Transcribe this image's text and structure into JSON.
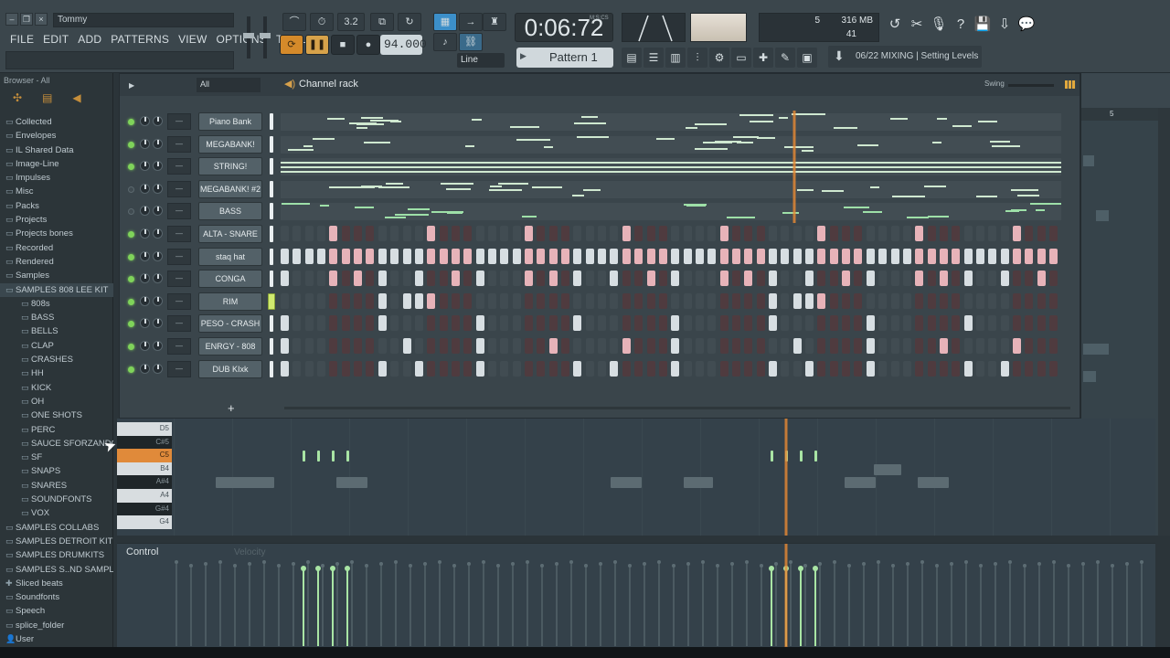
{
  "window": {
    "title": "Tommy",
    "menu": [
      "FILE",
      "EDIT",
      "ADD",
      "PATTERNS",
      "VIEW",
      "OPTIONS",
      "TOOLS",
      "?"
    ]
  },
  "transport": {
    "tempo": "94.000",
    "time": "0:06:72",
    "time_unit": "M:S:CS",
    "pattern": "Pattern 1",
    "snap": "Line",
    "counter_top": "3.2",
    "cpu_value": "5",
    "memory": "316 MB",
    "polyphony": "41"
  },
  "hint": {
    "text": "06/22  MIXING | Setting Levels"
  },
  "browser": {
    "header": "Browser - All",
    "items": [
      {
        "label": "Collected",
        "icon": "folder-icon",
        "level": 0
      },
      {
        "label": "Envelopes",
        "icon": "folder-icon",
        "level": 0
      },
      {
        "label": "IL Shared Data",
        "icon": "folder-icon",
        "level": 0
      },
      {
        "label": "Image-Line",
        "icon": "folder-icon",
        "level": 0
      },
      {
        "label": "Impulses",
        "icon": "folder-icon",
        "level": 0
      },
      {
        "label": "Misc",
        "icon": "folder-icon",
        "level": 0
      },
      {
        "label": "Packs",
        "icon": "folder-icon",
        "level": 0
      },
      {
        "label": "Projects",
        "icon": "folder-icon",
        "level": 0
      },
      {
        "label": "Projects bones",
        "icon": "folder-icon",
        "level": 0
      },
      {
        "label": "Recorded",
        "icon": "folder-icon",
        "level": 0
      },
      {
        "label": "Rendered",
        "icon": "folder-icon",
        "level": 0
      },
      {
        "label": "Samples",
        "icon": "folder-icon",
        "level": 0
      },
      {
        "label": "SAMPLES 808 LEE KIT",
        "icon": "folder-open-icon",
        "level": 0
      },
      {
        "label": "808s",
        "icon": "folder-icon",
        "level": 1
      },
      {
        "label": "BASS",
        "icon": "folder-icon",
        "level": 1
      },
      {
        "label": "BELLS",
        "icon": "folder-icon",
        "level": 1
      },
      {
        "label": "CLAP",
        "icon": "folder-icon",
        "level": 1
      },
      {
        "label": "CRASHES",
        "icon": "folder-icon",
        "level": 1
      },
      {
        "label": "HH",
        "icon": "folder-icon",
        "level": 1
      },
      {
        "label": "KICK",
        "icon": "folder-icon",
        "level": 1
      },
      {
        "label": "OH",
        "icon": "folder-icon",
        "level": 1
      },
      {
        "label": "ONE SHOTS",
        "icon": "folder-icon",
        "level": 1
      },
      {
        "label": "PERC",
        "icon": "folder-icon",
        "level": 1
      },
      {
        "label": "SAUCE SFORZANDO",
        "icon": "folder-icon",
        "level": 1
      },
      {
        "label": "SF",
        "icon": "folder-icon",
        "level": 1
      },
      {
        "label": "SNAPS",
        "icon": "folder-icon",
        "level": 1
      },
      {
        "label": "SNARES",
        "icon": "folder-icon",
        "level": 1
      },
      {
        "label": "SOUNDFONTS",
        "icon": "folder-icon",
        "level": 1
      },
      {
        "label": "VOX",
        "icon": "folder-icon",
        "level": 1
      },
      {
        "label": "SAMPLES COLLABS",
        "icon": "folder-icon",
        "level": 0
      },
      {
        "label": "SAMPLES DETROIT KITS",
        "icon": "folder-icon",
        "level": 0
      },
      {
        "label": "SAMPLES DRUMKITS",
        "icon": "folder-icon",
        "level": 0
      },
      {
        "label": "SAMPLES S..ND SAMPLES",
        "icon": "folder-icon",
        "level": 0
      },
      {
        "label": "Sliced beats",
        "icon": "sliced-icon",
        "level": 0
      },
      {
        "label": "Soundfonts",
        "icon": "folder-icon",
        "level": 0
      },
      {
        "label": "Speech",
        "icon": "folder-icon",
        "level": 0
      },
      {
        "label": "splice_folder",
        "icon": "folder-icon",
        "level": 0
      },
      {
        "label": "User",
        "icon": "user-icon",
        "level": 0
      }
    ]
  },
  "channel_rack": {
    "title": "Channel rack",
    "filter": "All",
    "swing_label": "Swing",
    "channels": [
      {
        "name": "Piano Bank",
        "led": true,
        "type": "roll"
      },
      {
        "name": "MEGABANK!",
        "led": true,
        "type": "roll"
      },
      {
        "name": "STRING!",
        "led": true,
        "type": "roll"
      },
      {
        "name": "MEGABANK! #2",
        "led": false,
        "type": "roll"
      },
      {
        "name": "BASS",
        "led": false,
        "type": "roll"
      },
      {
        "name": "ALTA - SNARE",
        "led": true,
        "type": "steps",
        "steps": [
          0,
          0,
          0,
          0,
          1,
          0,
          0,
          0,
          0,
          0,
          0,
          0,
          1,
          0,
          0,
          0,
          0,
          0,
          0,
          0,
          1,
          0,
          0,
          0,
          0,
          0,
          0,
          0,
          1,
          0,
          0,
          0,
          0,
          0,
          0,
          0,
          1,
          0,
          0,
          0,
          0,
          0,
          0,
          0,
          1,
          0,
          0,
          0,
          0,
          0,
          0,
          0,
          1,
          0,
          0,
          0,
          0,
          0,
          0,
          0,
          1,
          0,
          0,
          0
        ]
      },
      {
        "name": "staq hat",
        "led": true,
        "type": "steps",
        "steps": [
          1,
          1,
          1,
          1,
          1,
          1,
          1,
          1,
          1,
          1,
          1,
          1,
          1,
          1,
          1,
          1,
          1,
          1,
          1,
          1,
          1,
          1,
          1,
          1,
          1,
          1,
          1,
          1,
          1,
          1,
          1,
          1,
          1,
          1,
          1,
          1,
          1,
          1,
          1,
          1,
          1,
          1,
          1,
          1,
          1,
          1,
          1,
          1,
          1,
          1,
          1,
          1,
          1,
          1,
          1,
          1,
          1,
          1,
          1,
          1,
          1,
          1,
          1,
          1
        ]
      },
      {
        "name": "CONGA",
        "led": true,
        "type": "steps",
        "steps": [
          1,
          0,
          0,
          0,
          1,
          0,
          1,
          0,
          1,
          0,
          0,
          1,
          0,
          0,
          1,
          0,
          1,
          0,
          0,
          0,
          1,
          0,
          1,
          0,
          1,
          0,
          0,
          1,
          0,
          0,
          1,
          0,
          1,
          0,
          0,
          0,
          1,
          0,
          1,
          0,
          1,
          0,
          0,
          1,
          0,
          0,
          1,
          0,
          1,
          0,
          0,
          0,
          1,
          0,
          1,
          0,
          1,
          0,
          0,
          1,
          0,
          0,
          1,
          0
        ]
      },
      {
        "name": "RIM",
        "led": true,
        "type": "steps",
        "selected": true,
        "steps": [
          0,
          0,
          0,
          0,
          0,
          0,
          0,
          0,
          1,
          0,
          1,
          1,
          1,
          0,
          0,
          0,
          0,
          0,
          0,
          0,
          0,
          0,
          0,
          0,
          0,
          0,
          0,
          0,
          0,
          0,
          0,
          0,
          0,
          0,
          0,
          0,
          0,
          0,
          0,
          0,
          1,
          0,
          1,
          1,
          1,
          0,
          0,
          0,
          0,
          0,
          0,
          0,
          0,
          0,
          0,
          0,
          0,
          0,
          0,
          0,
          0,
          0,
          0,
          0
        ]
      },
      {
        "name": "PESO - CRASH",
        "led": true,
        "type": "steps",
        "steps": [
          1,
          0,
          0,
          0,
          0,
          0,
          0,
          0,
          1,
          0,
          0,
          0,
          0,
          0,
          0,
          0,
          1,
          0,
          0,
          0,
          0,
          0,
          0,
          0,
          1,
          0,
          0,
          0,
          0,
          0,
          0,
          0,
          1,
          0,
          0,
          0,
          0,
          0,
          0,
          0,
          1,
          0,
          0,
          0,
          0,
          0,
          0,
          0,
          1,
          0,
          0,
          0,
          0,
          0,
          0,
          0,
          1,
          0,
          0,
          0,
          0,
          0,
          0,
          0
        ]
      },
      {
        "name": "ENRGY - 808",
        "led": true,
        "type": "steps",
        "steps": [
          1,
          0,
          0,
          0,
          0,
          0,
          0,
          0,
          0,
          0,
          1,
          0,
          0,
          0,
          0,
          0,
          1,
          0,
          0,
          0,
          0,
          0,
          1,
          0,
          0,
          0,
          0,
          0,
          1,
          0,
          0,
          0,
          1,
          0,
          0,
          0,
          0,
          0,
          0,
          0,
          0,
          0,
          1,
          0,
          0,
          0,
          0,
          0,
          1,
          0,
          0,
          0,
          0,
          0,
          1,
          0,
          0,
          0,
          0,
          0,
          1,
          0,
          0,
          0
        ]
      },
      {
        "name": "DUB KIxk",
        "led": true,
        "type": "steps",
        "steps": [
          1,
          0,
          0,
          0,
          0,
          0,
          0,
          0,
          1,
          0,
          0,
          1,
          0,
          0,
          0,
          0,
          1,
          0,
          0,
          0,
          0,
          0,
          0,
          0,
          1,
          0,
          0,
          1,
          0,
          0,
          0,
          0,
          1,
          0,
          0,
          0,
          0,
          0,
          0,
          0,
          1,
          0,
          0,
          1,
          0,
          0,
          0,
          0,
          1,
          0,
          0,
          0,
          0,
          0,
          0,
          0,
          1,
          0,
          0,
          1,
          0,
          0,
          0,
          0
        ]
      }
    ]
  },
  "piano_roll": {
    "keys": [
      "D5",
      "C#5",
      "C5",
      "B4",
      "A#4",
      "A4",
      "G#4",
      "G4"
    ],
    "highlight_key": "C5"
  },
  "event_editor": {
    "label": "Control",
    "channel": "Velocity"
  },
  "playlist": {
    "bar_label": "5"
  },
  "colors": {
    "accent_orange": "#e88a33",
    "note_green": "#a9e5a4",
    "step_pink": "#e7b3b9",
    "step_white": "#d7dee2"
  }
}
